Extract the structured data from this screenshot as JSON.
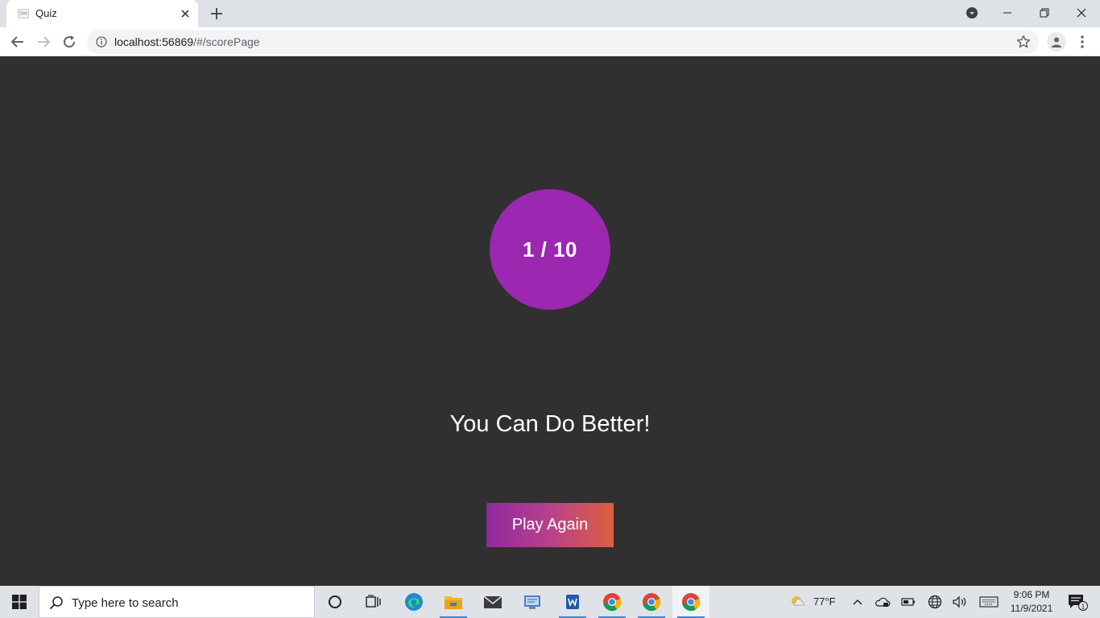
{
  "browser": {
    "tab_title": "Quiz",
    "favicon_text": "Quiz",
    "url_host": "localhost:56869",
    "url_path": "/#/scorePage"
  },
  "page": {
    "score_text": "1 / 10",
    "message": "You Can Do Better!",
    "play_again_label": "Play Again"
  },
  "taskbar": {
    "search_placeholder": "Type here to search",
    "weather_temp": "77°F",
    "time": "9:06 PM",
    "date": "11/9/2021",
    "notification_count": "1"
  },
  "colors": {
    "page_background": "#303030",
    "score_circle": "#9c27b0",
    "button_gradient_start": "#8e2aa0",
    "button_gradient_end": "#dd5f3d"
  }
}
